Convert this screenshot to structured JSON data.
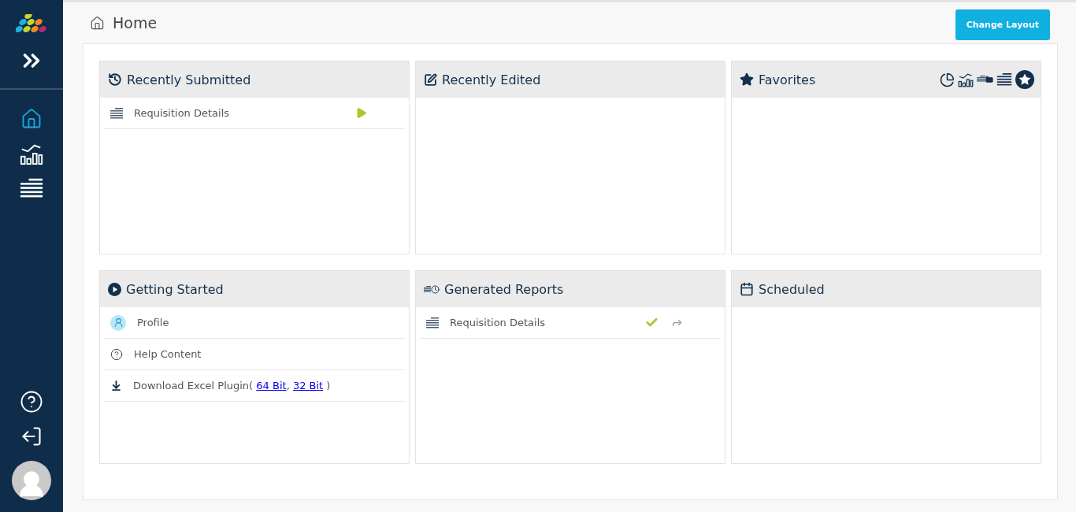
{
  "page": {
    "title": "Home"
  },
  "change_layout": "Change Layout",
  "sidebar": {
    "nav": [
      {
        "kind": "home",
        "selected": true
      },
      {
        "kind": "analytics",
        "selected": false
      },
      {
        "kind": "list",
        "selected": false
      }
    ]
  },
  "widgets": [
    {
      "title": "Recently Submitted",
      "kind": "history",
      "items": [
        {
          "kind": "report",
          "label": "Requisition Details",
          "actions": [
            {
              "kind": "run"
            }
          ]
        }
      ]
    },
    {
      "title": "Recently Edited",
      "kind": "edit"
    },
    {
      "title": "Favorites",
      "kind": "star",
      "tools": [
        {
          "kind": "pie"
        },
        {
          "kind": "analytics"
        },
        {
          "kind": "folders"
        },
        {
          "kind": "list"
        },
        {
          "kind": "badge"
        }
      ]
    },
    {
      "title": "Getting Started",
      "kind": "play",
      "items": [
        {
          "kind": "profile",
          "label": "Profile"
        },
        {
          "kind": "help",
          "label": "Help Content"
        },
        {
          "kind": "download",
          "parts": [
            {
              "kind": "text",
              "text": "Download Excel Plugin( "
            },
            {
              "kind": "link",
              "text": "64 Bit"
            },
            {
              "kind": "text",
              "text": ", "
            },
            {
              "kind": "link",
              "text": "32 Bit"
            },
            {
              "kind": "text",
              "text": " )"
            }
          ]
        }
      ]
    },
    {
      "title": "Generated Reports",
      "kind": "reports",
      "items": [
        {
          "kind": "report",
          "label": "Requisition Details",
          "actions": [
            {
              "kind": "done"
            },
            {
              "kind": "share"
            }
          ]
        }
      ]
    },
    {
      "title": "Scheduled",
      "kind": "calendar"
    }
  ]
}
